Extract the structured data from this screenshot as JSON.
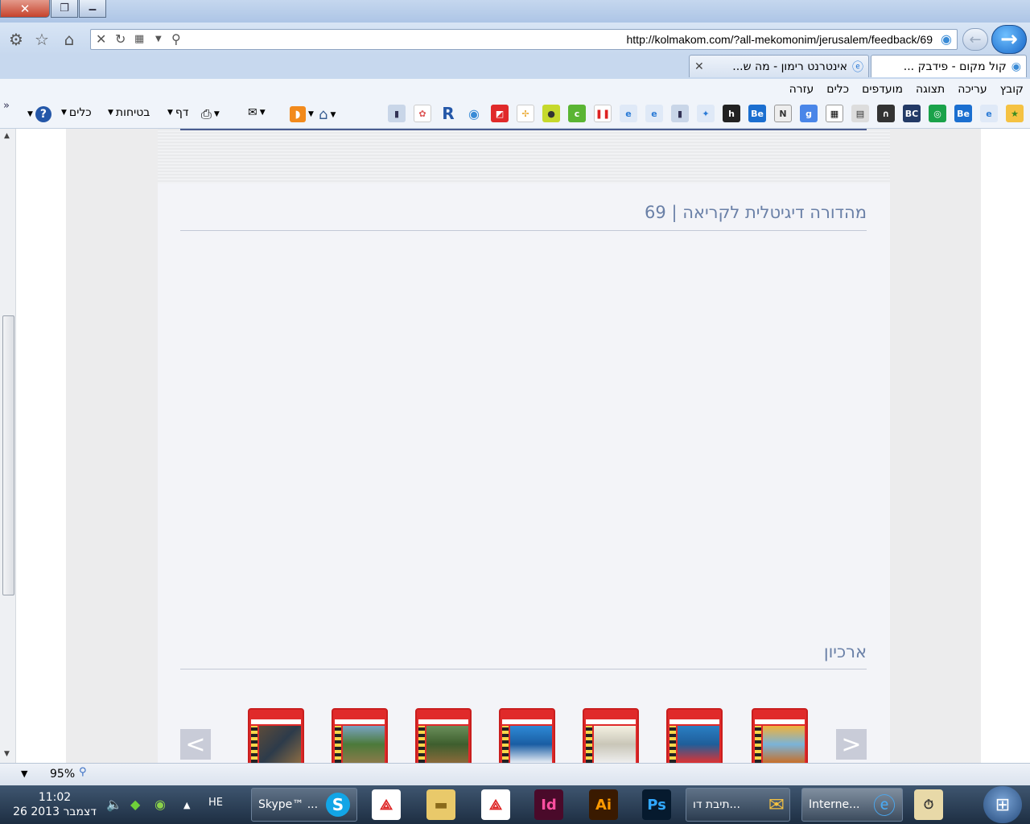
{
  "window": {
    "close_glyph": "✕",
    "restore_glyph": "❐",
    "minimize_glyph": "‒"
  },
  "address_bar": {
    "url": "http://kolmakom.com/?all-mekomonim/jerusalem/feedback/69"
  },
  "tabs": [
    {
      "title": "קול מקום - פידבק ...",
      "active": true
    },
    {
      "title": "אינטרנט רימון - מה ש...",
      "active": false
    }
  ],
  "menu": [
    "קובץ",
    "עריכה",
    "תצוגה",
    "מועדפים",
    "כלים",
    "עזרה"
  ],
  "command_bar": {
    "page_label": "דף",
    "safety_label": "בטיחות",
    "tools_label": "כלים",
    "more_glyph": "»"
  },
  "favorites_icons": [
    "favorites-star-icon",
    "ie-icon",
    "behance-icon",
    "bc-icon",
    "camera-icon",
    "qr-icon",
    "google-icon",
    "n-icon",
    "behance-icon",
    "h-icon",
    "site-icon",
    "folder-icon",
    "ie-icon",
    "ie-icon",
    "pause-icon",
    "c-icon",
    "lime-icon",
    "pinwheel-icon",
    "red-icon",
    "pin-icon",
    "r-icon",
    "gear-icon",
    "folder-icon"
  ],
  "page": {
    "digital_title": "מהדורה דיגיטלית לקריאה | 69",
    "archive_title": "ארכיון",
    "prev_glyph": "<",
    "next_glyph": ">",
    "archive_thumbnail_count": 7
  },
  "status": {
    "zoom": "95%"
  },
  "taskbar": {
    "time": "11:02",
    "date": "26 דצמבר 2013",
    "language": "HE",
    "buttons": [
      {
        "label": "Skype™ ..."
      },
      {
        "label": "תיבת דו..."
      },
      {
        "label": "Interne..."
      }
    ],
    "app_icons": [
      "acrobat-icon",
      "explorer-folder-icon",
      "acrobat-icon",
      "indesign-icon",
      "illustrator-icon",
      "photoshop-icon",
      "timekeeper-icon"
    ],
    "indesign_label": "Id",
    "illustrator_label": "Ai",
    "photoshop_label": "Ps"
  },
  "colors": {
    "title_text": "#6a80a7",
    "archive_red": "#e02a2a",
    "page_bg": "#f3f4f8"
  }
}
